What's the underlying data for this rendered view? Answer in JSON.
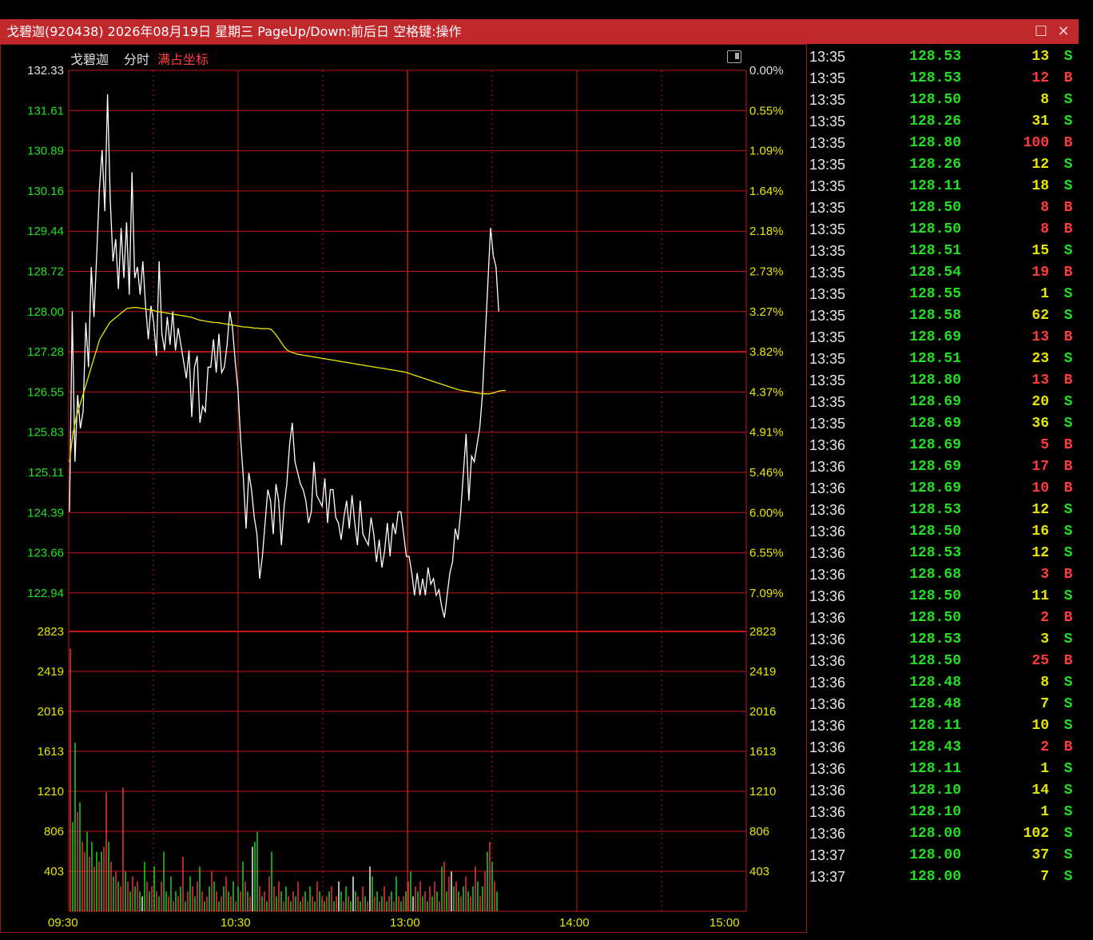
{
  "window": {
    "title": "戈碧迦(920438) 2026年08月19日 星期三 PageUp/Down:前后日 空格键:操作",
    "maximize_icon": "square-icon",
    "close_icon": "close-icon"
  },
  "chart_header": {
    "stock_name": "戈碧迦",
    "mode": "分时",
    "axis_mode": "满占坐标"
  },
  "colors": {
    "grid": "#c01818",
    "up": "#22e022",
    "down": "#ff3b3b",
    "price_line": "#ffffff",
    "avg_line": "#e6e600",
    "buy": "#ff3b3b",
    "sell": "#22e022",
    "neutral_vol": "#e6e600"
  },
  "chart_data": {
    "type": "line",
    "price_axis_left": [
      "132.33",
      "131.61",
      "130.89",
      "130.16",
      "129.44",
      "128.72",
      "128.00",
      "127.28",
      "126.55",
      "125.83",
      "125.11",
      "124.39",
      "123.66",
      "122.94"
    ],
    "price_axis_right": [
      "0.00%",
      "0.55%",
      "1.09%",
      "1.64%",
      "2.18%",
      "2.73%",
      "3.27%",
      "3.82%",
      "4.37%",
      "4.91%",
      "5.46%",
      "6.00%",
      "6.55%",
      "7.09%"
    ],
    "volume_axis": [
      "2823",
      "2419",
      "2016",
      "1613",
      "1210",
      "806",
      "403"
    ],
    "time_labels": [
      "09:30",
      "10:30",
      "13:00",
      "14:00",
      "15:00"
    ],
    "ylim": [
      122.22,
      132.33
    ],
    "vol_max": 2823,
    "minutes_total": 240,
    "price": [
      124.4,
      128.0,
      125.3,
      126.5,
      125.9,
      126.2,
      127.8,
      127.0,
      128.8,
      127.9,
      129.0,
      130.2,
      130.9,
      129.8,
      131.9,
      130.0,
      128.9,
      129.3,
      128.4,
      129.5,
      128.6,
      129.6,
      128.3,
      130.5,
      128.6,
      128.8,
      128.3,
      128.9,
      128.1,
      127.5,
      128.1,
      127.8,
      127.2,
      128.9,
      127.6,
      127.3,
      127.9,
      127.4,
      128.0,
      127.3,
      127.7,
      127.4,
      127.1,
      126.8,
      127.3,
      126.1,
      127.0,
      127.2,
      126.0,
      126.3,
      126.2,
      127.0,
      127.0,
      127.5,
      126.9,
      127.6,
      126.9,
      127.0,
      127.4,
      128.0,
      127.7,
      127.1,
      126.6,
      125.7,
      125.0,
      124.1,
      125.1,
      124.8,
      124.3,
      124.0,
      123.2,
      123.6,
      124.2,
      124.8,
      124.6,
      124.0,
      124.9,
      124.6,
      123.8,
      124.5,
      124.9,
      125.6,
      126.0,
      125.3,
      125.1,
      124.9,
      124.8,
      124.6,
      124.2,
      124.4,
      125.3,
      124.7,
      124.6,
      124.5,
      125.0,
      124.2,
      124.8,
      124.8,
      124.3,
      124.2,
      123.9,
      124.3,
      124.6,
      124.1,
      124.7,
      124.2,
      123.8,
      124.6,
      124.0,
      123.9,
      123.8,
      124.3,
      124.0,
      123.5,
      123.9,
      123.4,
      123.7,
      124.2,
      123.6,
      124.2,
      124.0,
      124.4,
      124.4,
      124.0,
      123.6,
      123.6,
      123.3,
      122.9,
      123.3,
      122.9,
      123.2,
      122.9,
      123.4,
      123.1,
      123.2,
      122.9,
      123.0,
      122.7,
      122.5,
      122.9,
      123.3,
      123.5,
      124.1,
      123.9,
      124.4,
      125.1,
      125.8,
      124.6,
      125.4,
      125.3,
      125.6,
      125.9,
      126.5,
      127.5,
      128.5,
      129.5,
      129.0,
      128.8,
      128.0
    ],
    "avg": [
      125.3,
      125.8,
      126.1,
      126.3,
      126.5,
      126.7,
      126.9,
      127.1,
      127.3,
      127.5,
      127.6,
      127.7,
      127.8,
      127.85,
      127.9,
      127.95,
      128.0,
      128.05,
      128.06,
      128.07,
      128.07,
      128.06,
      128.05,
      128.04,
      128.03,
      128.02,
      128.0,
      127.99,
      127.98,
      127.97,
      127.96,
      127.95,
      127.94,
      127.93,
      127.92,
      127.91,
      127.9,
      127.88,
      127.86,
      127.84,
      127.83,
      127.82,
      127.81,
      127.8,
      127.8,
      127.79,
      127.78,
      127.77,
      127.76,
      127.75,
      127.74,
      127.73,
      127.72,
      127.72,
      127.71,
      127.7,
      127.7,
      127.69,
      127.69,
      127.69,
      127.68,
      127.62,
      127.54,
      127.45,
      127.36,
      127.3,
      127.27,
      127.25,
      127.23,
      127.22,
      127.21,
      127.2,
      127.19,
      127.18,
      127.17,
      127.16,
      127.15,
      127.14,
      127.13,
      127.12,
      127.11,
      127.1,
      127.09,
      127.08,
      127.07,
      127.06,
      127.05,
      127.04,
      127.03,
      127.02,
      127.01,
      127.0,
      126.99,
      126.98,
      126.97,
      126.96,
      126.95,
      126.94,
      126.93,
      126.92,
      126.91,
      126.89,
      126.87,
      126.85,
      126.83,
      126.81,
      126.79,
      126.77,
      126.75,
      126.73,
      126.71,
      126.69,
      126.67,
      126.65,
      126.63,
      126.61,
      126.59,
      126.58,
      126.57,
      126.56,
      126.55,
      126.54,
      126.53,
      126.52,
      126.52,
      126.52,
      126.53,
      126.55,
      126.57,
      126.58,
      126.58
    ],
    "volume": [
      2650,
      900,
      1700,
      1000,
      1100,
      700,
      600,
      800,
      550,
      700,
      450,
      600,
      500,
      600,
      650,
      1200,
      700,
      500,
      350,
      400,
      300,
      250,
      1250,
      400,
      300,
      200,
      350,
      250,
      300,
      200,
      150,
      500,
      300,
      200,
      250,
      450,
      200,
      150,
      300,
      600,
      200,
      150,
      350,
      100,
      200,
      150,
      250,
      550,
      100,
      200,
      350,
      250,
      150,
      300,
      450,
      200,
      100,
      150,
      250,
      400,
      300,
      200,
      100,
      150,
      250,
      350,
      200,
      150,
      300,
      100,
      250,
      200,
      500,
      300,
      200,
      150,
      650,
      700,
      800,
      250,
      150,
      200,
      100,
      350,
      600,
      250,
      150,
      300,
      200,
      100,
      250,
      150,
      100,
      200,
      150,
      300,
      100,
      150,
      200,
      100,
      250,
      150,
      100,
      300,
      200,
      150,
      100,
      150,
      200,
      250,
      100,
      150,
      300,
      200,
      100,
      250,
      150,
      100,
      350,
      200,
      150,
      100,
      250,
      150,
      100,
      450,
      350,
      150,
      200,
      100,
      150,
      250,
      100,
      150,
      200,
      100,
      350,
      150,
      100,
      150,
      200,
      300,
      400,
      150,
      250,
      200,
      300,
      150,
      200,
      100,
      250,
      150,
      300,
      200,
      100,
      450,
      500,
      200,
      350,
      400,
      250,
      300,
      200,
      150,
      250,
      350,
      200,
      150,
      250,
      450,
      300,
      150,
      250,
      400,
      600,
      700,
      500,
      300,
      200
    ],
    "volume_dir": [
      "r",
      "g",
      "g",
      "r",
      "g",
      "r",
      "r",
      "g",
      "r",
      "g",
      "r",
      "g",
      "r",
      "g",
      "r",
      "r",
      "g",
      "r",
      "g",
      "r",
      "g",
      "r",
      "r",
      "g",
      "r",
      "g",
      "r",
      "g",
      "r",
      "g",
      "w",
      "g",
      "r",
      "g",
      "r",
      "g",
      "r",
      "g",
      "r",
      "g",
      "g",
      "r",
      "g",
      "r",
      "g",
      "r",
      "g",
      "r",
      "g",
      "r",
      "g",
      "r",
      "g",
      "r",
      "g",
      "r",
      "g",
      "r",
      "g",
      "r",
      "g",
      "r",
      "g",
      "r",
      "g",
      "r",
      "g",
      "r",
      "g",
      "r",
      "g",
      "r",
      "g",
      "r",
      "g",
      "r",
      "w",
      "g",
      "g",
      "r",
      "g",
      "r",
      "g",
      "r",
      "g",
      "r",
      "g",
      "r",
      "g",
      "r",
      "g",
      "r",
      "g",
      "r",
      "g",
      "r",
      "g",
      "r",
      "g",
      "r",
      "g",
      "r",
      "g",
      "r",
      "g",
      "r",
      "g",
      "r",
      "g",
      "r",
      "g",
      "r",
      "w",
      "g",
      "r",
      "g",
      "r",
      "g",
      "w",
      "g",
      "r",
      "g",
      "r",
      "g",
      "r",
      "w",
      "g",
      "r",
      "g",
      "r",
      "g",
      "r",
      "g",
      "r",
      "g",
      "r",
      "g",
      "r",
      "g",
      "r",
      "g",
      "r",
      "g",
      "w",
      "r",
      "g",
      "r",
      "g",
      "r",
      "g",
      "r",
      "g",
      "r",
      "g",
      "r",
      "g",
      "r",
      "g",
      "r",
      "w",
      "g",
      "r",
      "g",
      "r",
      "g",
      "r",
      "g",
      "r",
      "g",
      "r",
      "g",
      "r",
      "g",
      "r",
      "g",
      "r",
      "g",
      "r",
      "g",
      "r",
      "g",
      "r",
      "g",
      "w",
      "r",
      "g",
      "r"
    ]
  },
  "ticks": [
    {
      "time": "13:35",
      "price": "128.53",
      "vol": "13",
      "dir": "S"
    },
    {
      "time": "13:35",
      "price": "128.53",
      "vol": "12",
      "dir": "B"
    },
    {
      "time": "13:35",
      "price": "128.50",
      "vol": "8",
      "dir": "S"
    },
    {
      "time": "13:35",
      "price": "128.26",
      "vol": "31",
      "dir": "S"
    },
    {
      "time": "13:35",
      "price": "128.80",
      "vol": "100",
      "dir": "B"
    },
    {
      "time": "13:35",
      "price": "128.26",
      "vol": "12",
      "dir": "S"
    },
    {
      "time": "13:35",
      "price": "128.11",
      "vol": "18",
      "dir": "S"
    },
    {
      "time": "13:35",
      "price": "128.50",
      "vol": "8",
      "dir": "B"
    },
    {
      "time": "13:35",
      "price": "128.50",
      "vol": "8",
      "dir": "B"
    },
    {
      "time": "13:35",
      "price": "128.51",
      "vol": "15",
      "dir": "S"
    },
    {
      "time": "13:35",
      "price": "128.54",
      "vol": "19",
      "dir": "B"
    },
    {
      "time": "13:35",
      "price": "128.55",
      "vol": "1",
      "dir": "S"
    },
    {
      "time": "13:35",
      "price": "128.58",
      "vol": "62",
      "dir": "S"
    },
    {
      "time": "13:35",
      "price": "128.69",
      "vol": "13",
      "dir": "B"
    },
    {
      "time": "13:35",
      "price": "128.51",
      "vol": "23",
      "dir": "S"
    },
    {
      "time": "13:35",
      "price": "128.80",
      "vol": "13",
      "dir": "B"
    },
    {
      "time": "13:35",
      "price": "128.69",
      "vol": "20",
      "dir": "S"
    },
    {
      "time": "13:35",
      "price": "128.69",
      "vol": "36",
      "dir": "S"
    },
    {
      "time": "13:36",
      "price": "128.69",
      "vol": "5",
      "dir": "B"
    },
    {
      "time": "13:36",
      "price": "128.69",
      "vol": "17",
      "dir": "B"
    },
    {
      "time": "13:36",
      "price": "128.69",
      "vol": "10",
      "dir": "B"
    },
    {
      "time": "13:36",
      "price": "128.53",
      "vol": "12",
      "dir": "S"
    },
    {
      "time": "13:36",
      "price": "128.50",
      "vol": "16",
      "dir": "S"
    },
    {
      "time": "13:36",
      "price": "128.53",
      "vol": "12",
      "dir": "S"
    },
    {
      "time": "13:36",
      "price": "128.68",
      "vol": "3",
      "dir": "B"
    },
    {
      "time": "13:36",
      "price": "128.50",
      "vol": "11",
      "dir": "S"
    },
    {
      "time": "13:36",
      "price": "128.50",
      "vol": "2",
      "dir": "B"
    },
    {
      "time": "13:36",
      "price": "128.53",
      "vol": "3",
      "dir": "S"
    },
    {
      "time": "13:36",
      "price": "128.50",
      "vol": "25",
      "dir": "B"
    },
    {
      "time": "13:36",
      "price": "128.48",
      "vol": "8",
      "dir": "S"
    },
    {
      "time": "13:36",
      "price": "128.48",
      "vol": "7",
      "dir": "S"
    },
    {
      "time": "13:36",
      "price": "128.11",
      "vol": "10",
      "dir": "S"
    },
    {
      "time": "13:36",
      "price": "128.43",
      "vol": "2",
      "dir": "B"
    },
    {
      "time": "13:36",
      "price": "128.11",
      "vol": "1",
      "dir": "S"
    },
    {
      "time": "13:36",
      "price": "128.10",
      "vol": "14",
      "dir": "S"
    },
    {
      "time": "13:36",
      "price": "128.10",
      "vol": "1",
      "dir": "S"
    },
    {
      "time": "13:36",
      "price": "128.00",
      "vol": "102",
      "dir": "S"
    },
    {
      "time": "13:37",
      "price": "128.00",
      "vol": "37",
      "dir": "S"
    },
    {
      "time": "13:37",
      "price": "128.00",
      "vol": "7",
      "dir": "S"
    }
  ]
}
